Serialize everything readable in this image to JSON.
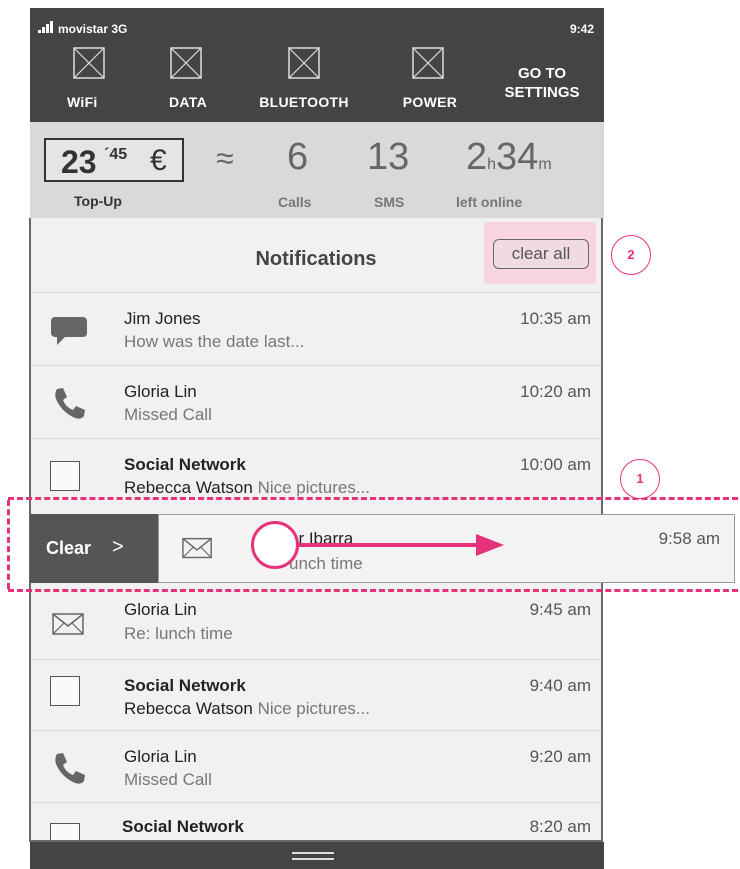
{
  "status_bar": {
    "carrier": "movistar 3G",
    "time": "9:42"
  },
  "toggles": [
    {
      "label": "WiFi",
      "icon": "wifi-placeholder-icon"
    },
    {
      "label": "DATA",
      "icon": "data-placeholder-icon"
    },
    {
      "label": "BLUETOOTH",
      "icon": "bluetooth-placeholder-icon"
    },
    {
      "label": "POWER",
      "icon": "power-placeholder-icon"
    }
  ],
  "settings_button": {
    "line1": "GO TO",
    "line2": "SETTINGS"
  },
  "usage": {
    "amount": "23",
    "cents": "´45",
    "currency": "€",
    "topup_label": "Top-Up",
    "approx_symbol": "≈",
    "calls_value": "6",
    "calls_label": "Calls",
    "sms_value": "13",
    "sms_label": "SMS",
    "hours_value": "2",
    "hours_unit": "h",
    "minutes_value": "34",
    "minutes_unit": "m",
    "online_label": "left online"
  },
  "notifications": {
    "title": "Notifications",
    "clear_all_label": "clear all",
    "items": [
      {
        "name": "Jim Jones",
        "bold": false,
        "sub": "How was the date last...",
        "sender": "",
        "time": "10:35 am",
        "icon": "chat-bubble-icon"
      },
      {
        "name": "Gloria Lin",
        "bold": false,
        "sub": "Missed Call",
        "sender": "",
        "time": "10:20 am",
        "icon": "phone-icon"
      },
      {
        "name": "Social Network",
        "bold": true,
        "sender": "Rebecca Watson",
        "sub": "Nice pictures...",
        "time": "10:00 am",
        "icon": "app-placeholder-icon"
      },
      {
        "name": "Gloria Lin",
        "bold": false,
        "sub": "Re: lunch time",
        "sender": "",
        "time": "9:45 am",
        "icon": "mail-icon"
      },
      {
        "name": "Social Network",
        "bold": true,
        "sender": "Rebecca Watson",
        "sub": "Nice pictures...",
        "time": "9:40 am",
        "icon": "app-placeholder-icon"
      },
      {
        "name": "Gloria Lin",
        "bold": false,
        "sub": "Missed Call",
        "sender": "",
        "time": "9:20 am",
        "icon": "phone-icon"
      },
      {
        "name": "Social Network",
        "bold": true,
        "sender": "",
        "sub": "",
        "time": "8:20 am",
        "icon": "app-placeholder-icon"
      }
    ],
    "swiped_item": {
      "clear_label": "Clear",
      "clear_chevron": ">",
      "name": "or Ibarra",
      "sub": "unch time",
      "time": "9:58 am",
      "icon": "mail-icon"
    }
  },
  "annotations": {
    "callout_1": "1",
    "callout_2": "2"
  },
  "colors": {
    "dark_bar": "#444444",
    "usage_bg": "#d9d9d9",
    "panel_bg": "#f1f1f1",
    "accent_pink": "#e6317b",
    "highlight_pink": "#f8d5e1"
  }
}
